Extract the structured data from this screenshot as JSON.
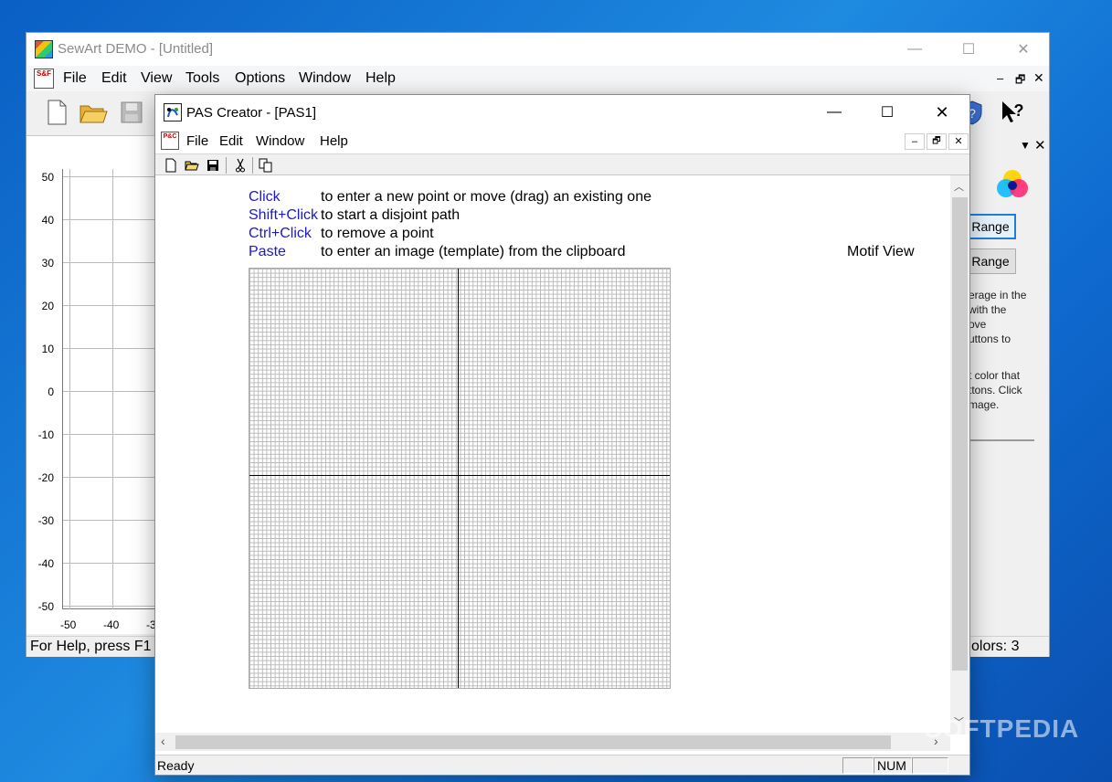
{
  "sewart": {
    "title": "SewArt DEMO - [Untitled]",
    "menu": [
      "File",
      "Edit",
      "View",
      "Tools",
      "Options",
      "Window",
      "Help"
    ],
    "window_buttons": {
      "minimize": "—",
      "maximize": "☐",
      "close": "✕"
    },
    "mdi_buttons": {
      "minimize": "–",
      "restore": "🗗",
      "close": "✕"
    },
    "chart": {
      "y_ticks": [
        "50",
        "40",
        "30",
        "20",
        "10",
        "0",
        "-10",
        "-20",
        "-30",
        "-40",
        "-50"
      ],
      "x_ticks": [
        "-50",
        "-40",
        "-3"
      ]
    },
    "panel": {
      "range_button_1": "Range",
      "range_button_2": "Range",
      "help_lines_1": [
        "erage in the",
        "with the",
        "ove",
        "uttons to"
      ],
      "help_lines_2": [
        "t color that",
        "ttons. Click",
        "mage."
      ]
    },
    "status": {
      "help": "For Help, press F1",
      "colors": "olors: 3"
    }
  },
  "pas": {
    "title": "PAS Creator - [PAS1]",
    "menu": [
      "File",
      "Edit",
      "Window",
      "Help"
    ],
    "mdi_buttons": {
      "minimize": "–",
      "restore": "🗗",
      "close": "✕"
    },
    "window_buttons": {
      "minimize": "—",
      "maximize": "☐",
      "close": "✕"
    },
    "instructions": [
      {
        "key": "Click",
        "text": "to enter a new point or move (drag) an existing one"
      },
      {
        "key": "Shift+Click",
        "text": "to start a disjoint path"
      },
      {
        "key": "Ctrl+Click",
        "text": "to remove a point"
      },
      {
        "key": "Paste",
        "text": "to enter an image (template) from the clipboard"
      }
    ],
    "motif_view": "Motif View",
    "status": {
      "ready": "Ready",
      "num": "NUM"
    }
  },
  "watermark": "SOFTPEDIA",
  "colors": {
    "keyword_blue": "#1a1acc",
    "desktop_blue": "#1e8ae0"
  }
}
